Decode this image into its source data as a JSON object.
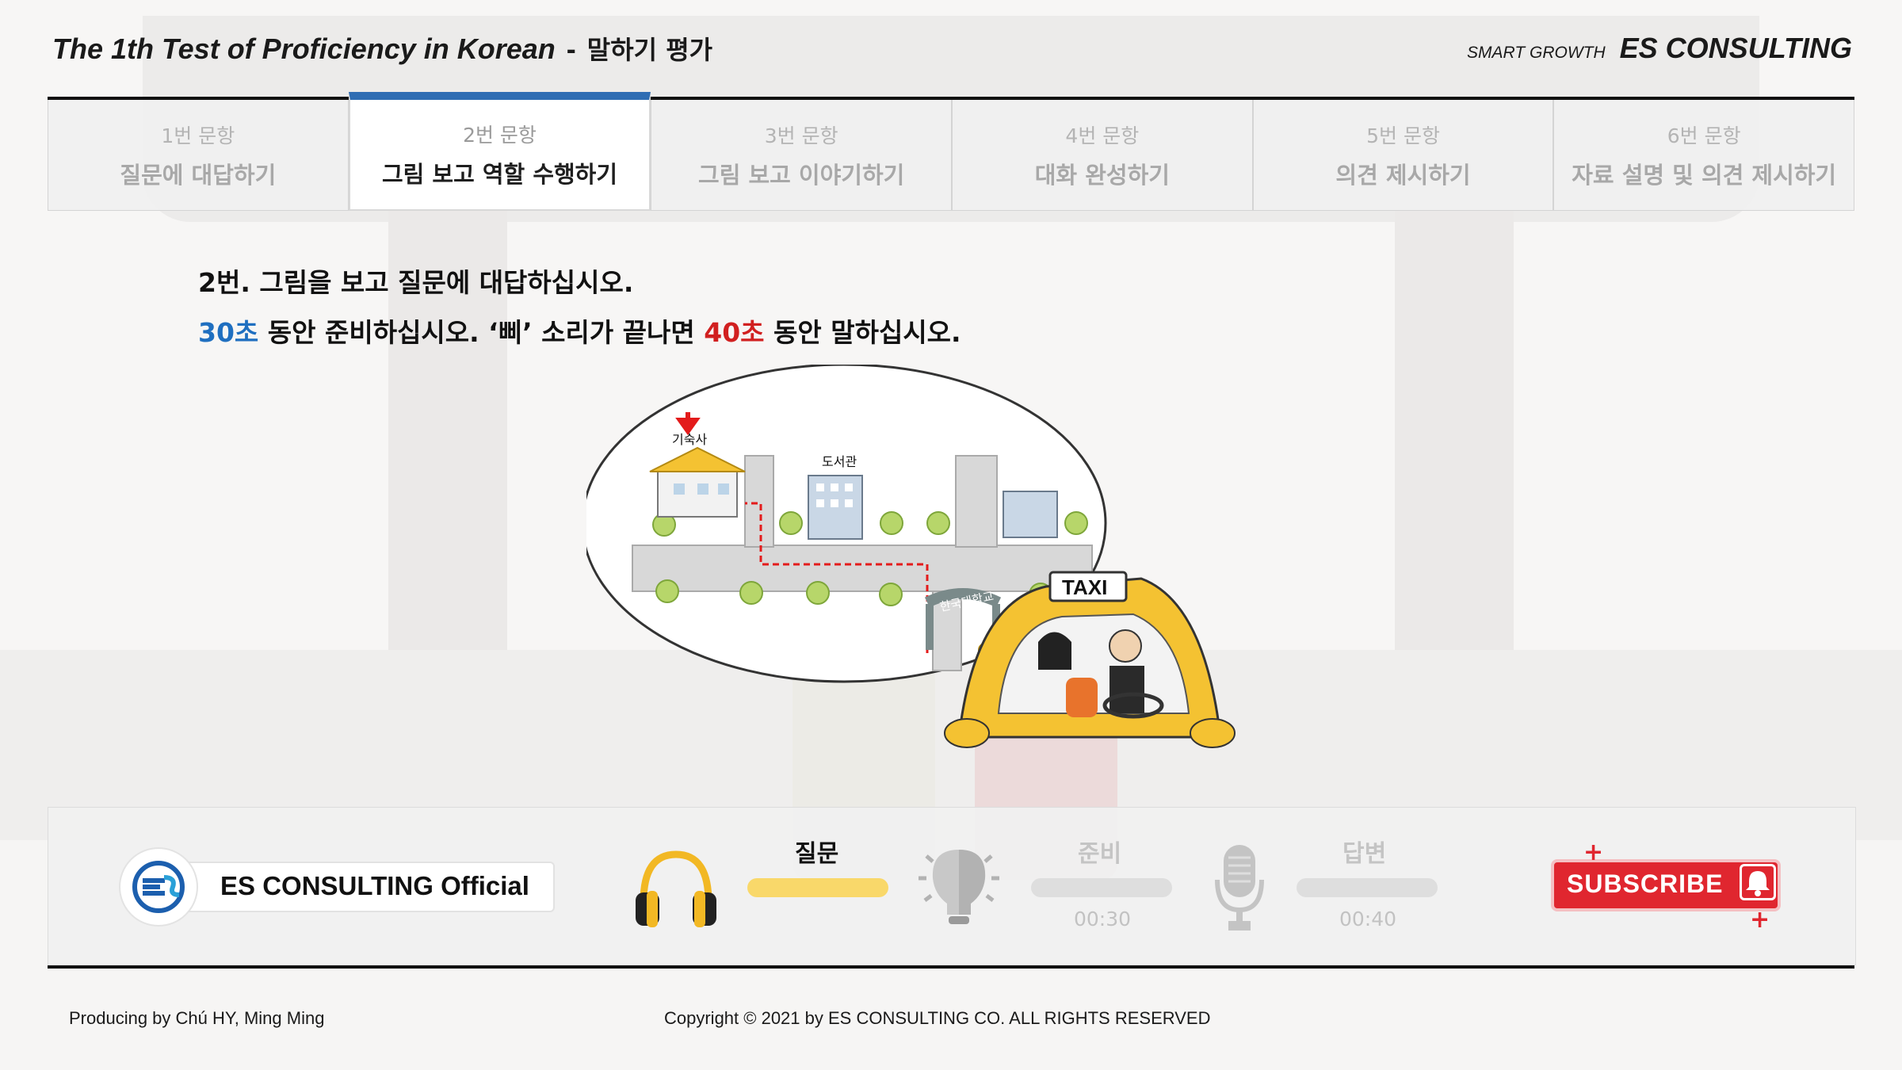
{
  "header": {
    "title": "The 1th Test of Proficiency in Korean",
    "separator": "-",
    "subtitle_ko": "말하기 평가",
    "brand_tagline": "SMART GROWTH",
    "brand_name": "ES CONSULTING"
  },
  "tabs": [
    {
      "num": "1번 문항",
      "name": "질문에 대답하기",
      "active": false
    },
    {
      "num": "2번 문항",
      "name": "그림 보고 역할 수행하기",
      "active": true
    },
    {
      "num": "3번 문항",
      "name": "그림 보고 이야기하기",
      "active": false
    },
    {
      "num": "4번 문항",
      "name": "대화 완성하기",
      "active": false
    },
    {
      "num": "5번 문항",
      "name": "의견 제시하기",
      "active": false
    },
    {
      "num": "6번 문항",
      "name": "자료 설명 및 의견 제시하기",
      "active": false
    }
  ],
  "question": {
    "line1": "2번. 그림을 보고 질문에 대답하십시오.",
    "prep_time": "30초",
    "prep_text": " 동안 준비하십시오. ‘삐’ 소리가 끝나면 ",
    "answer_time": "40초",
    "answer_text": " 동안 말하십시오."
  },
  "illustration": {
    "dorm_label": "기숙사",
    "library_label": "도서관",
    "gate_label": "한국대학교",
    "taxi_sign": "TAXI"
  },
  "controls": {
    "channel_name": "ES CONSULTING Official",
    "steps": [
      {
        "label": "질문",
        "time": ""
      },
      {
        "label": "준비",
        "time": "00:30"
      },
      {
        "label": "답변",
        "time": "00:40"
      }
    ],
    "subscribe_label": "SUBSCRIBE"
  },
  "colors": {
    "accent_tab": "#2f6db3",
    "prep_blue": "#1f6fc0",
    "answer_red": "#d12020",
    "question_bar": "#f9d86a",
    "subscribe_red": "#e0262f"
  },
  "footer": {
    "producer": "Producing by Chú HY, Ming Ming",
    "copyright": "Copyright © 2021 by ES CONSULTING CO. ALL RIGHTS RESERVED"
  }
}
